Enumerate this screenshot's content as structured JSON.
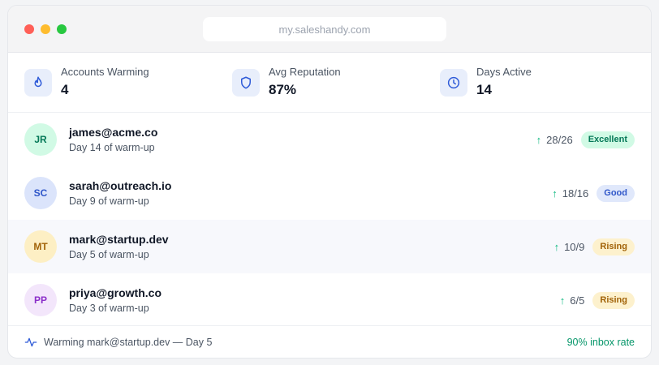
{
  "browser": {
    "url": "my.saleshandy.com"
  },
  "stats": [
    {
      "label": "Accounts Warming",
      "value": "4",
      "icon": "flame-icon"
    },
    {
      "label": "Avg Reputation",
      "value": "87%",
      "icon": "shield-icon"
    },
    {
      "label": "Days Active",
      "value": "14",
      "icon": "clock-icon"
    }
  ],
  "accounts": [
    {
      "initials": "JR",
      "email": "james@acme.co",
      "subtitle": "Day 14 of warm-up",
      "metric": "28/26",
      "badge": "Excellent",
      "avatar_bg": "#d1fae5",
      "avatar_fg": "#047857",
      "badge_bg": "#d1fae5",
      "badge_fg": "#047857"
    },
    {
      "initials": "SC",
      "email": "sarah@outreach.io",
      "subtitle": "Day 9 of warm-up",
      "metric": "18/16",
      "badge": "Good",
      "avatar_bg": "#dbe4fb",
      "avatar_fg": "#2f56c9",
      "badge_bg": "#e0e8fb",
      "badge_fg": "#2f56c9"
    },
    {
      "initials": "MT",
      "email": "mark@startup.dev",
      "subtitle": "Day 5 of warm-up",
      "metric": "10/9",
      "badge": "Rising",
      "avatar_bg": "#fdefc4",
      "avatar_fg": "#a16207",
      "badge_bg": "#fdf1cd",
      "badge_fg": "#a16207"
    },
    {
      "initials": "PP",
      "email": "priya@growth.co",
      "subtitle": "Day 3 of warm-up",
      "metric": "6/5",
      "badge": "Rising",
      "avatar_bg": "#f3e6fb",
      "avatar_fg": "#8b2fc9",
      "badge_bg": "#fdf1cd",
      "badge_fg": "#a16207"
    }
  ],
  "footer": {
    "status": "Warming mark@startup.dev — Day 5",
    "rate": "90% inbox rate",
    "icon": "activity-icon"
  },
  "colors": {
    "accent": "#2f5bd8",
    "trend_up": "#10b981",
    "rate_text": "#059669"
  }
}
